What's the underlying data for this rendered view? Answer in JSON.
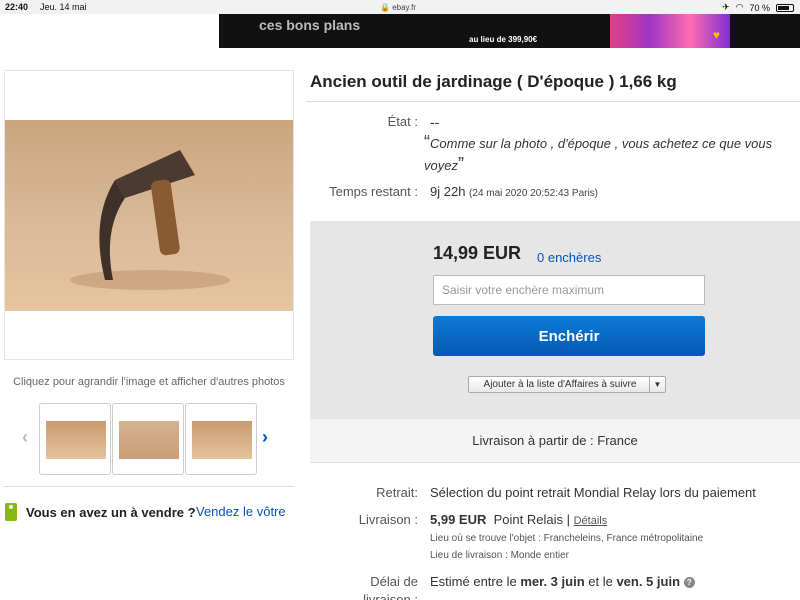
{
  "status_bar": {
    "time": "22:40",
    "date": "Jeu. 14 mai",
    "url": "ebay.fr",
    "battery": "70 %"
  },
  "ad_banner": {
    "text": "ces bons plans",
    "price": "au lieu de 399,90€"
  },
  "gallery": {
    "caption": "Cliquez pour agrandir l'image et afficher d'autres photos",
    "thumbnail_count": 3
  },
  "sell": {
    "question": "Vous en avez un à vendre ?",
    "link": "Vendez le vôtre"
  },
  "listing": {
    "title": "Ancien outil de jardinage ( D'époque ) 1,66 kg",
    "condition_label": "État :",
    "condition_value": "--",
    "quote_open": "“",
    "quote_text": "Comme sur la photo , d'époque , vous achetez ce que vous voyez",
    "quote_close": "”",
    "time_label": "Temps restant :",
    "time_value": "9j 22h",
    "time_detail": "(24 mai 2020   20:52:43 Paris)"
  },
  "bid": {
    "price": "14,99 EUR",
    "bids_link": "0 enchères",
    "input_placeholder": "Saisir votre enchère maximum",
    "button": "Enchérir",
    "watch_button": "Ajouter à la liste d'Affaires à suivre"
  },
  "shipping": {
    "from": "Livraison à partir de : France",
    "pickup_label": "Retrait:",
    "pickup_value": "Sélection du point retrait Mondial Relay lors du paiement",
    "delivery_label": "Livraison :",
    "delivery_price": "5,99 EUR",
    "delivery_method": "Point Relais |",
    "details_link": "Détails",
    "item_location": "Lieu où se trouve l'objet :  Francheleins, France métropolitaine",
    "ship_to": "Lieu de livraison :  Monde entier",
    "delay_label_1": "Délai de",
    "delay_label_2": "livraison :",
    "delay_prefix": "Estimé entre le ",
    "delay_date_1": "mer. 3 juin",
    "delay_mid": " et le ",
    "delay_date_2": "ven. 5 juin"
  }
}
